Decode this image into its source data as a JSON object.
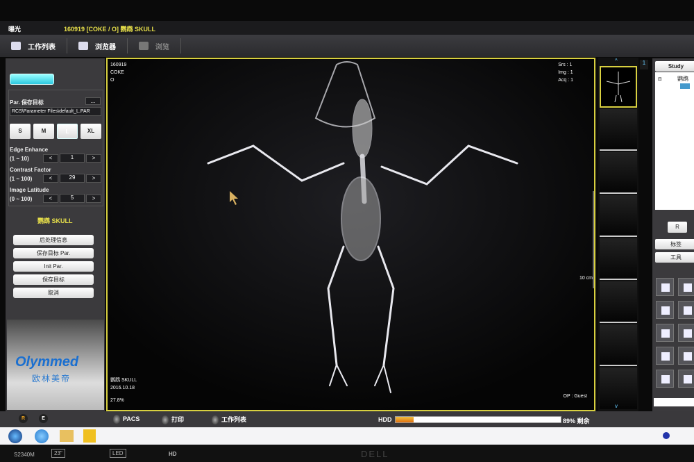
{
  "titlebar": {
    "app": "曝光",
    "document": "160919 [COKE / O] 鹦鹉 SKULL"
  },
  "toolbar": {
    "worklist": "工作列表",
    "browser": "浏览器",
    "browse": "浏览"
  },
  "left": {
    "par_label": "Par. 保存目标",
    "more": "...",
    "par_path": "RCS\\Parameter Files\\default_L.PAR",
    "sizes": [
      "S",
      "M",
      "L",
      "XL"
    ],
    "selected_size": "L",
    "edge_label": "Edge Enhance",
    "edge_range": "(1 ~ 10)",
    "edge_value": "1",
    "contrast_label": "Contrast Factor",
    "contrast_range": "(1 ~ 100)",
    "contrast_value": "29",
    "latitude_label": "Image Latitude",
    "latitude_range": "(0 ~ 100)",
    "latitude_value": "5",
    "prev": "<",
    "next": ">",
    "exam": "鹦鹉 SKULL",
    "buttons": [
      "后处理信息",
      "保存目标 Par.",
      "Init Par.",
      "保存目标",
      "取消"
    ],
    "logo": "Olymmed",
    "logo_cn": "欧林美帝"
  },
  "viewer": {
    "id": "160919",
    "name": "COKE",
    "sex": "O",
    "srs": "Srs : 1",
    "img": "Img : 1",
    "acq": "Acq : 1",
    "scale": "10 cm",
    "exam": "鹦鹉 SKULL",
    "date": "2016.10.18",
    "zoom": "27.8%",
    "op": "OP : Guest"
  },
  "thumbs": {
    "count": "1"
  },
  "right": {
    "study": "Study",
    "tree_item": "鹦鹉",
    "r": "R",
    "label": "标签",
    "tools": "工具"
  },
  "status": {
    "pacs": "PACS",
    "print": "打印",
    "worklist": "工作列表",
    "hdd": "HDD",
    "hdd_used_percent": 11,
    "hdd_text": "89% 剩余",
    "round_r": "R",
    "round_e": "E"
  },
  "bezel": {
    "model": "S2340M",
    "size": "23\"",
    "led": "LED",
    "hd": "HD",
    "brand": "DELL"
  },
  "colors": {
    "accent": "#d8d040",
    "hdd_bar": "#e8a020"
  }
}
